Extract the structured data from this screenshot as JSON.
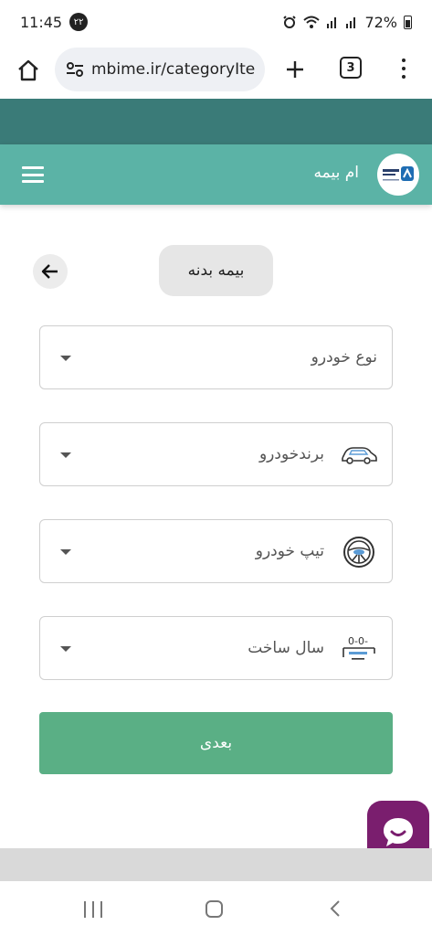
{
  "status_bar": {
    "time": "11:45",
    "notif_badge": "۲۲",
    "battery_text": "72%"
  },
  "browser": {
    "url": "mbime.ir/categoryIte",
    "tab_count": "3"
  },
  "app": {
    "brand_name": "ام بیمه",
    "theme_color": "#5bb3a6",
    "top_band_color": "#3a7b78"
  },
  "page": {
    "category_chip": "بیمه بدنه"
  },
  "form": {
    "fields": [
      {
        "label": "نوع خودرو",
        "icon": "none"
      },
      {
        "label": "برندخودرو",
        "icon": "car-icon"
      },
      {
        "label": "تیپ خودرو",
        "icon": "steering-wheel-icon"
      },
      {
        "label": "سال ساخت",
        "icon": "calendar-year-icon"
      }
    ],
    "next_label": "بعدی",
    "next_color": "#5aaf85"
  },
  "chat": {
    "icon": "chat-bubble-icon",
    "color": "#7a1e6e"
  }
}
